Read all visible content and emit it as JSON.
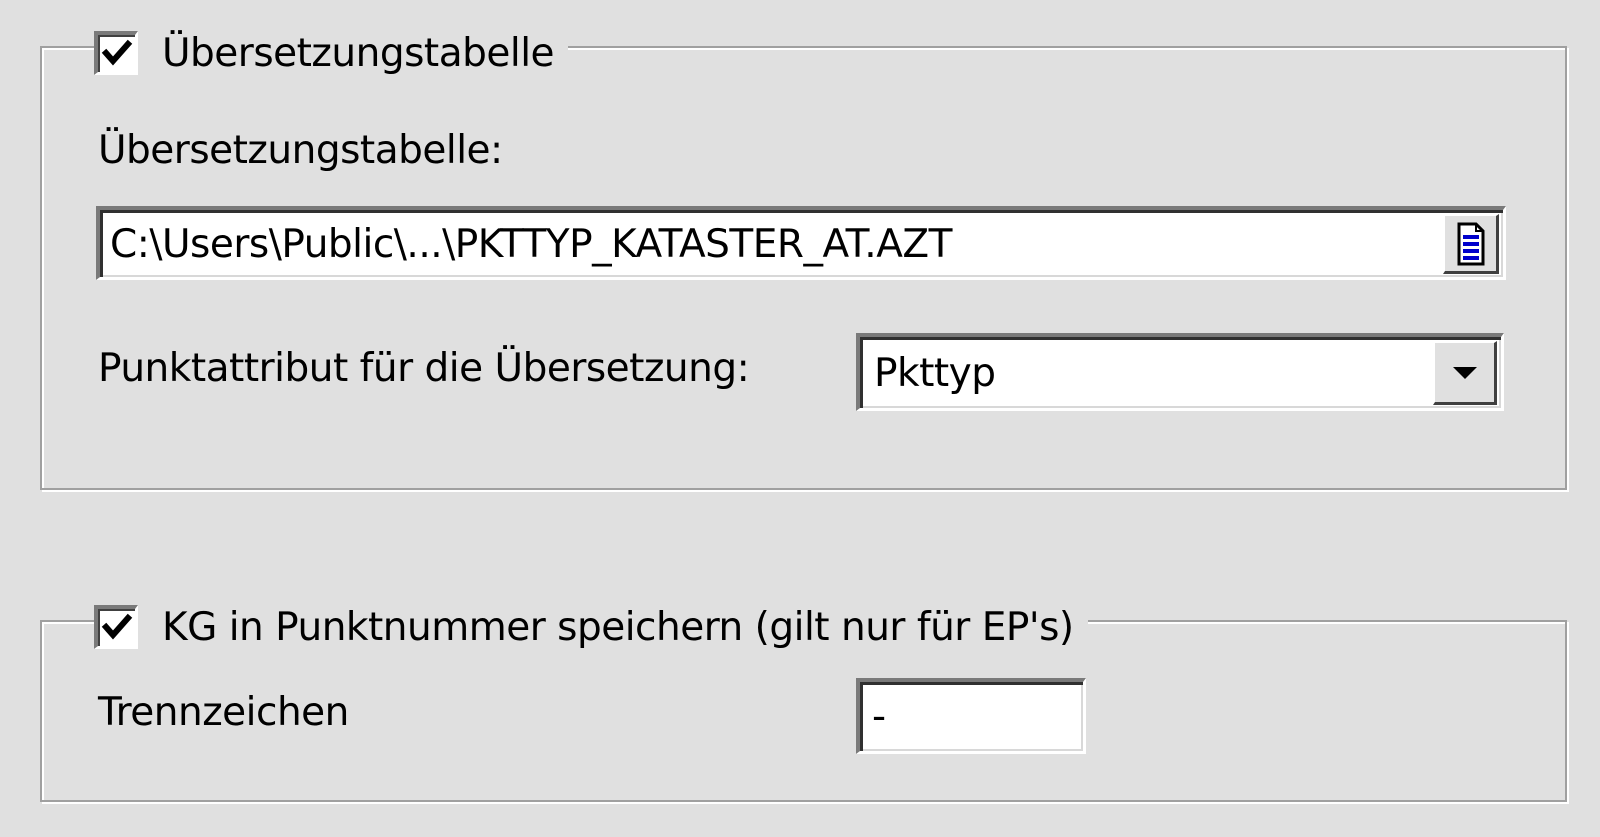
{
  "translation_group": {
    "checkbox_checked": true,
    "title": "Übersetzungstabelle",
    "table_label": "Übersetzungstabelle:",
    "table_path": "C:\\Users\\Public\\...\\PKTTYP_KATASTER_AT.AZT",
    "browse_icon": "document-icon",
    "attribute_label": "Punktattribut für die Übersetzung:",
    "attribute_selected": "Pkttyp",
    "dropdown_icon": "chevron-down-icon"
  },
  "kg_group": {
    "checkbox_checked": true,
    "title": "KG in Punktnummer speichern (gilt nur für EP's)",
    "separator_label": "Trennzeichen",
    "separator_value": "-"
  },
  "colors": {
    "background": "#e0e0e0",
    "field_background": "#ffffff",
    "browse_icon_accent": "#0000cc"
  }
}
